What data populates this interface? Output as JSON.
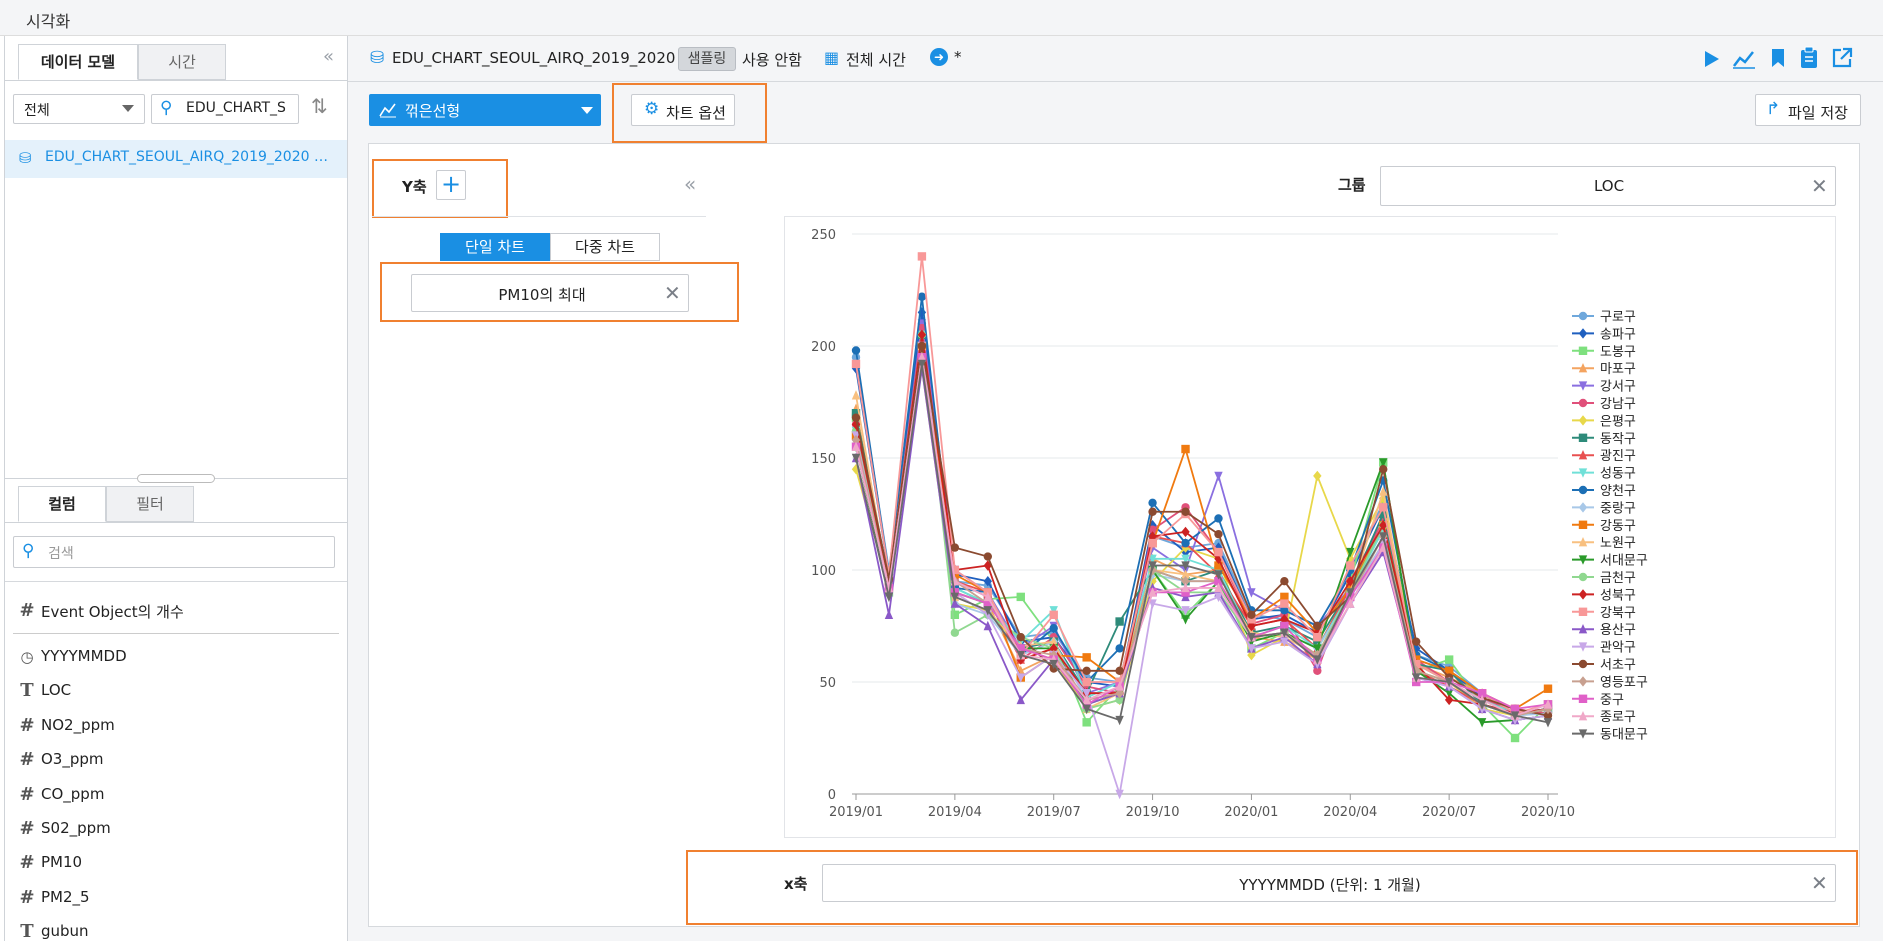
{
  "app": {
    "title": "시각화"
  },
  "left": {
    "tabs": [
      "데이터 모델",
      "시간"
    ],
    "filter_select": "전체",
    "search_value": "EDU_CHART_S",
    "model_item": "EDU_CHART_SEOUL_AIRQ_2019_2020 …",
    "bottom_tabs": [
      "컬럼",
      "필터"
    ],
    "column_search_placeholder": "검색",
    "columns": [
      {
        "icon": "#",
        "name": "Event Object의 개수"
      },
      {
        "icon": "clock",
        "name": "YYYYMMDD"
      },
      {
        "icon": "T",
        "name": "LOC"
      },
      {
        "icon": "#",
        "name": "NO2_ppm"
      },
      {
        "icon": "#",
        "name": "O3_ppm"
      },
      {
        "icon": "#",
        "name": "CO_ppm"
      },
      {
        "icon": "#",
        "name": "S02_ppm"
      },
      {
        "icon": "#",
        "name": "PM10"
      },
      {
        "icon": "#",
        "name": "PM2_5"
      },
      {
        "icon": "T",
        "name": "gubun"
      }
    ]
  },
  "header": {
    "dataset": "EDU_CHART_SEOUL_AIRQ_2019_2020",
    "sampling_chip": "샘플링",
    "sampling_status": "사용 안함",
    "time_label": "전체 시간",
    "modified_mark": "*"
  },
  "toolbar": {
    "chart_type": "꺾은선형",
    "chart_options": "차트 옵션",
    "save_file": "파일 저장"
  },
  "config": {
    "y_axis_label": "Y축",
    "single_chart": "단일 차트",
    "multi_chart": "다중 차트",
    "y_field": "PM10의 최대",
    "group_label": "그룹",
    "group_field": "LOC",
    "x_axis_label": "x축",
    "x_field": "YYYYMMDD (단위: 1 개월)"
  },
  "colors": {
    "accent": "#1a8fe3",
    "highlight": "#f08030"
  },
  "chart_data": {
    "type": "line",
    "x": [
      "2019/01",
      "2019/02",
      "2019/03",
      "2019/04",
      "2019/05",
      "2019/06",
      "2019/07",
      "2019/08",
      "2019/09",
      "2019/10",
      "2019/11",
      "2019/12",
      "2020/01",
      "2020/02",
      "2020/03",
      "2020/04",
      "2020/05",
      "2020/06",
      "2020/07",
      "2020/08",
      "2020/09",
      "2020/10"
    ],
    "x_ticks": [
      "2019/01",
      "2019/04",
      "2019/07",
      "2019/10",
      "2020/01",
      "2020/04",
      "2020/07",
      "2020/10"
    ],
    "y_ticks": [
      0,
      50,
      100,
      150,
      200,
      250
    ],
    "ylim": [
      0,
      250
    ],
    "grid": true,
    "legend_position": "right",
    "series": [
      {
        "name": "구로구",
        "color": "#6fa8dc",
        "marker": "circle",
        "values": [
          195,
          100,
          210,
          95,
          93,
          70,
          72,
          52,
          50,
          115,
          110,
          112,
          80,
          78,
          70,
          100,
          130,
          62,
          57,
          45,
          35,
          38
        ]
      },
      {
        "name": "송파구",
        "color": "#1f5fbf",
        "marker": "diamond",
        "values": [
          190,
          98,
          215,
          98,
          95,
          68,
          70,
          50,
          48,
          120,
          108,
          110,
          78,
          80,
          72,
          98,
          128,
          65,
          55,
          43,
          36,
          36
        ]
      },
      {
        "name": "도봉구",
        "color": "#7ee07e",
        "marker": "square",
        "values": [
          168,
          90,
          200,
          80,
          87,
          88,
          68,
          32,
          48,
          100,
          80,
          95,
          65,
          72,
          60,
          95,
          148,
          55,
          60,
          40,
          25,
          40
        ]
      },
      {
        "name": "마포구",
        "color": "#f4a460",
        "marker": "triangle",
        "values": [
          172,
          92,
          205,
          90,
          85,
          55,
          62,
          40,
          45,
          105,
          98,
          100,
          70,
          68,
          60,
          88,
          112,
          58,
          52,
          45,
          35,
          38
        ]
      },
      {
        "name": "강서구",
        "color": "#8a6fe0",
        "marker": "triangle-down",
        "values": [
          160,
          95,
          210,
          100,
          90,
          65,
          75,
          45,
          50,
          110,
          100,
          142,
          90,
          82,
          75,
          92,
          125,
          60,
          55,
          40,
          35,
          40
        ]
      },
      {
        "name": "강남구",
        "color": "#e0507a",
        "marker": "circle",
        "values": [
          165,
          96,
          208,
          95,
          88,
          60,
          70,
          48,
          45,
          118,
          128,
          108,
          76,
          80,
          55,
          95,
          122,
          60,
          50,
          42,
          38,
          36
        ]
      },
      {
        "name": "은평구",
        "color": "#e8d84a",
        "marker": "diamond",
        "values": [
          145,
          92,
          190,
          85,
          82,
          65,
          60,
          38,
          42,
          95,
          110,
          105,
          62,
          70,
          142,
          105,
          132,
          58,
          50,
          38,
          35,
          38
        ]
      },
      {
        "name": "동작구",
        "color": "#2e8b7a",
        "marker": "square",
        "values": [
          170,
          95,
          205,
          92,
          85,
          65,
          68,
          45,
          77,
          100,
          95,
          100,
          72,
          75,
          68,
          92,
          125,
          58,
          55,
          40,
          36,
          38
        ]
      },
      {
        "name": "광진구",
        "color": "#e85050",
        "marker": "triangle",
        "values": [
          160,
          95,
          200,
          95,
          90,
          60,
          65,
          45,
          45,
          115,
          112,
          98,
          75,
          78,
          65,
          92,
          118,
          55,
          48,
          40,
          36,
          38
        ]
      },
      {
        "name": "성동구",
        "color": "#70e0d8",
        "marker": "triangle-down",
        "values": [
          162,
          96,
          205,
          92,
          85,
          68,
          82,
          43,
          50,
          105,
          105,
          100,
          70,
          75,
          65,
          90,
          118,
          58,
          50,
          42,
          36,
          38
        ]
      },
      {
        "name": "양천구",
        "color": "#1c6fb5",
        "marker": "circle",
        "values": [
          198,
          98,
          222,
          92,
          90,
          62,
          74,
          50,
          65,
          130,
          112,
          123,
          82,
          82,
          75,
          100,
          140,
          62,
          55,
          45,
          36,
          38
        ]
      },
      {
        "name": "중랑구",
        "color": "#a8c8e8",
        "marker": "diamond",
        "values": [
          158,
          92,
          195,
          85,
          80,
          62,
          68,
          42,
          45,
          98,
          95,
          95,
          70,
          72,
          65,
          88,
          112,
          55,
          50,
          40,
          35,
          36
        ]
      },
      {
        "name": "강동구",
        "color": "#f07a10",
        "marker": "square",
        "values": [
          160,
          95,
          200,
          98,
          90,
          52,
          62,
          61,
          50,
          112,
          154,
          102,
          78,
          88,
          72,
          92,
          120,
          60,
          55,
          45,
          38,
          47
        ]
      },
      {
        "name": "노원구",
        "color": "#f8c080",
        "marker": "triangle",
        "values": [
          178,
          92,
          200,
          88,
          82,
          66,
          68,
          38,
          45,
          100,
          98,
          95,
          72,
          70,
          62,
          90,
          135,
          55,
          50,
          40,
          35,
          38
        ]
      },
      {
        "name": "서대문구",
        "color": "#2a9a2a",
        "marker": "triangle-down",
        "values": [
          155,
          90,
          195,
          90,
          85,
          65,
          65,
          40,
          45,
          100,
          78,
          95,
          68,
          72,
          65,
          108,
          148,
          55,
          45,
          32,
          33,
          35
        ]
      },
      {
        "name": "금천구",
        "color": "#90d890",
        "marker": "circle",
        "values": [
          162,
          95,
          205,
          72,
          80,
          70,
          65,
          38,
          42,
          100,
          90,
          90,
          70,
          72,
          62,
          90,
          120,
          55,
          50,
          40,
          35,
          38
        ]
      },
      {
        "name": "성북구",
        "color": "#cc2222",
        "marker": "diamond",
        "values": [
          165,
          95,
          205,
          100,
          102,
          60,
          65,
          45,
          45,
          115,
          117,
          105,
          75,
          78,
          72,
          95,
          120,
          58,
          42,
          40,
          36,
          38
        ]
      },
      {
        "name": "강북구",
        "color": "#f89898",
        "marker": "square",
        "values": [
          192,
          98,
          240,
          100,
          90,
          62,
          80,
          50,
          50,
          112,
          125,
          108,
          78,
          85,
          70,
          102,
          128,
          58,
          50,
          45,
          36,
          40
        ]
      },
      {
        "name": "용산구",
        "color": "#8a58c8",
        "marker": "triangle",
        "values": [
          150,
          80,
          190,
          85,
          75,
          42,
          60,
          40,
          45,
          92,
          88,
          90,
          65,
          70,
          58,
          85,
          108,
          52,
          48,
          38,
          33,
          35
        ]
      },
      {
        "name": "관악구",
        "color": "#c8a8e8",
        "marker": "triangle-down",
        "values": [
          160,
          90,
          200,
          90,
          80,
          52,
          62,
          45,
          0,
          85,
          82,
          88,
          65,
          68,
          58,
          85,
          112,
          52,
          48,
          38,
          33,
          35
        ]
      },
      {
        "name": "서초구",
        "color": "#8b4a30",
        "marker": "circle",
        "values": [
          168,
          96,
          200,
          110,
          106,
          70,
          56,
          55,
          55,
          126,
          126,
          116,
          80,
          95,
          75,
          88,
          145,
          68,
          52,
          43,
          38,
          35
        ]
      },
      {
        "name": "영등포구",
        "color": "#c8a090",
        "marker": "diamond",
        "values": [
          158,
          92,
          195,
          95,
          85,
          65,
          62,
          42,
          45,
          100,
          95,
          95,
          70,
          72,
          62,
          88,
          115,
          55,
          50,
          40,
          35,
          38
        ]
      },
      {
        "name": "중구",
        "color": "#e060c8",
        "marker": "square",
        "values": [
          155,
          92,
          195,
          90,
          85,
          65,
          60,
          40,
          48,
          90,
          90,
          95,
          70,
          75,
          60,
          88,
          110,
          50,
          50,
          45,
          38,
          40
        ]
      },
      {
        "name": "종로구",
        "color": "#f0a8c8",
        "marker": "triangle",
        "values": [
          155,
          92,
          195,
          95,
          88,
          62,
          60,
          42,
          48,
          90,
          92,
          92,
          70,
          72,
          60,
          85,
          110,
          52,
          50,
          42,
          35,
          40
        ]
      },
      {
        "name": "동대문구",
        "color": "#6a6a6a",
        "marker": "triangle-down",
        "values": [
          150,
          88,
          192,
          88,
          82,
          62,
          58,
          38,
          33,
          102,
          102,
          98,
          70,
          72,
          60,
          90,
          115,
          52,
          50,
          40,
          35,
          32
        ]
      }
    ]
  }
}
